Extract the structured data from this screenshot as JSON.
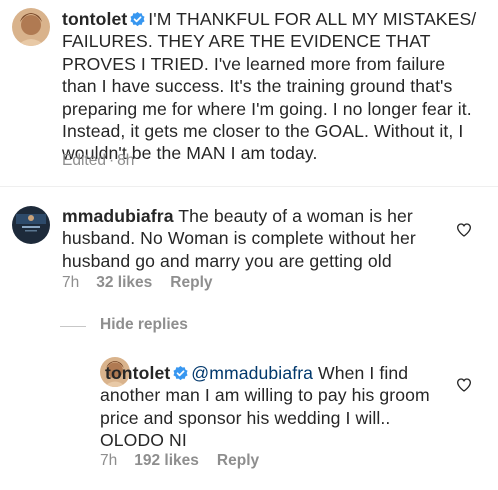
{
  "post": {
    "username": "tontolet",
    "caption": "I'M THANKFUL FOR ALL MY MISTAKES/ FAILURES. THEY ARE THE EVIDENCE THAT PROVES I TRIED. I've learned more from failure than I have success. It's the training ground that's preparing me for where I'm going. I no longer fear it. Instead, it gets me closer to the GOAL. Without it, I wouldn't be the MAN I am today.",
    "edited": "Edited",
    "time": "8h",
    "separator": "·"
  },
  "comment": {
    "username": "mmadubiafra",
    "text": "The beauty of a woman is her husband. No Woman is complete without her husband go and marry you are getting old",
    "time": "7h",
    "likes": "32 likes",
    "reply_label": "Reply"
  },
  "hide_replies_label": "Hide replies",
  "reply": {
    "username": "tontolet",
    "mention": "@mmadubiafra",
    "text": "When I find another man I am willing to pay his groom price and sponsor his wedding I will.. OLODO NI",
    "time": "7h",
    "likes": "192 likes",
    "reply_label": "Reply"
  },
  "colors": {
    "text": "#262626",
    "muted": "#8e8e8e",
    "verified": "#3897f0",
    "mention": "#00376b"
  }
}
